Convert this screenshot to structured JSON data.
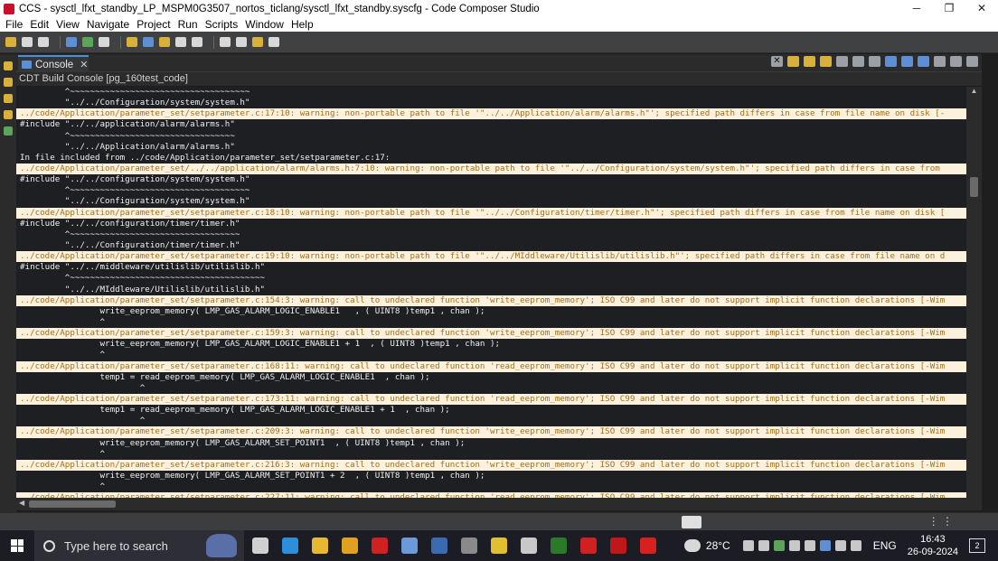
{
  "window": {
    "title": "CCS - sysctl_lfxt_standby_LP_MSPM0G3507_nortos_ticlang/sysctl_lfxt_standby.syscfg - Code Composer Studio",
    "minimize": "─",
    "maximize": "❐",
    "close": "✕"
  },
  "menu": [
    "File",
    "Edit",
    "View",
    "Navigate",
    "Project",
    "Run",
    "Scripts",
    "Window",
    "Help"
  ],
  "console_tab": {
    "label": "Console",
    "close": "✕"
  },
  "console_header": "CDT Build Console [pg_160test_code]",
  "console_lines": [
    {
      "text": "         ^~~~~~~~~~~~~~~~~~~~~~~~~~~~~~~~~~~~~",
      "warn": false
    },
    {
      "text": "         \"../../Configuration/system/system.h\"",
      "warn": false
    },
    {
      "text": "../code/Application/parameter_set/setparameter.c:17:10: warning: non-portable path to file '\"../../Application/alarm/alarms.h\"'; specified path differs in case from file name on disk [-",
      "warn": true
    },
    {
      "text": "#include \"../../application/alarm/alarms.h\"",
      "warn": false
    },
    {
      "text": "         ^~~~~~~~~~~~~~~~~~~~~~~~~~~~~~~~~~",
      "warn": false
    },
    {
      "text": "         \"../../Application/alarm/alarms.h\"",
      "warn": false
    },
    {
      "text": "In file included from ../code/Application/parameter_set/setparameter.c:17:",
      "warn": false
    },
    {
      "text": "../code/Application/parameter_set/../../application/alarm/alarms.h:7:10: warning: non-portable path to file '\"../../Configuration/system/system.h\"'; specified path differs in case from",
      "warn": true
    },
    {
      "text": "#include \"../../configuration/system/system.h\"",
      "warn": false
    },
    {
      "text": "         ^~~~~~~~~~~~~~~~~~~~~~~~~~~~~~~~~~~~~",
      "warn": false
    },
    {
      "text": "         \"../../Configuration/system/system.h\"",
      "warn": false
    },
    {
      "text": "../code/Application/parameter_set/setparameter.c:18:10: warning: non-portable path to file '\"../../Configuration/timer/timer.h\"'; specified path differs in case from file name on disk [",
      "warn": true
    },
    {
      "text": "#include \"../../configuration/timer/timer.h\"",
      "warn": false
    },
    {
      "text": "         ^~~~~~~~~~~~~~~~~~~~~~~~~~~~~~~~~~~",
      "warn": false
    },
    {
      "text": "         \"../../Configuration/timer/timer.h\"",
      "warn": false
    },
    {
      "text": "../code/Application/parameter_set/setparameter.c:19:10: warning: non-portable path to file '\"../../MIddleware/Utilislib/utilislib.h\"'; specified path differs in case from file name on d",
      "warn": true
    },
    {
      "text": "#include \"../../middleware/utilislib/utilislib.h\"",
      "warn": false
    },
    {
      "text": "         ^~~~~~~~~~~~~~~~~~~~~~~~~~~~~~~~~~~~~~~~",
      "warn": false
    },
    {
      "text": "         \"../../MIddleware/Utilislib/utilislib.h\"",
      "warn": false
    },
    {
      "text": "../code/Application/parameter_set/setparameter.c:154:3: warning: call to undeclared function 'write_eeprom_memory'; ISO C99 and later do not support implicit function declarations [-Wim",
      "warn": true
    },
    {
      "text": "                write_eeprom_memory( LMP_GAS_ALARM_LOGIC_ENABLE1   , ( UINT8 )temp1 , chan );",
      "warn": false
    },
    {
      "text": "                ^",
      "warn": false
    },
    {
      "text": "../code/Application/parameter_set/setparameter.c:159:3: warning: call to undeclared function 'write_eeprom_memory'; ISO C99 and later do not support implicit function declarations [-Wim",
      "warn": true
    },
    {
      "text": "                write_eeprom_memory( LMP_GAS_ALARM_LOGIC_ENABLE1 + 1  , ( UINT8 )temp1 , chan );",
      "warn": false
    },
    {
      "text": "                ^",
      "warn": false
    },
    {
      "text": "../code/Application/parameter_set/setparameter.c:168:11: warning: call to undeclared function 'read_eeprom_memory'; ISO C99 and later do not support implicit function declarations [-Wim",
      "warn": true
    },
    {
      "text": "                temp1 = read_eeprom_memory( LMP_GAS_ALARM_LOGIC_ENABLE1  , chan );",
      "warn": false
    },
    {
      "text": "                        ^",
      "warn": false
    },
    {
      "text": "../code/Application/parameter_set/setparameter.c:173:11: warning: call to undeclared function 'read_eeprom_memory'; ISO C99 and later do not support implicit function declarations [-Wim",
      "warn": true
    },
    {
      "text": "                temp1 = read_eeprom_memory( LMP_GAS_ALARM_LOGIC_ENABLE1 + 1  , chan );",
      "warn": false
    },
    {
      "text": "                        ^",
      "warn": false
    },
    {
      "text": "../code/Application/parameter_set/setparameter.c:209:3: warning: call to undeclared function 'write_eeprom_memory'; ISO C99 and later do not support implicit function declarations [-Wim",
      "warn": true
    },
    {
      "text": "                write_eeprom_memory( LMP_GAS_ALARM_SET_POINT1  , ( UINT8 )temp1 , chan );",
      "warn": false
    },
    {
      "text": "                ^",
      "warn": false
    },
    {
      "text": "../code/Application/parameter_set/setparameter.c:216:3: warning: call to undeclared function 'write_eeprom_memory'; ISO C99 and later do not support implicit function declarations [-Wim",
      "warn": true
    },
    {
      "text": "                write_eeprom_memory( LMP_GAS_ALARM_SET_POINT1 + 2  , ( UINT8 )temp1 , chan );",
      "warn": false
    },
    {
      "text": "                ^",
      "warn": false
    },
    {
      "text": "../code/Application/parameter_set/setparameter.c:227:11: warning: call to undeclared function 'read_eeprom_memory'; ISO C99 and later do not support implicit function declarations [-Wim",
      "warn": true
    }
  ],
  "colors": {
    "warning_bg": "#fbf1dd",
    "warning_fg": "#a46f1d",
    "console_bg": "#1e1f22",
    "accent": "#4a8ed8"
  },
  "taskbar": {
    "search_placeholder": "Type here to search",
    "weather": "28°C",
    "language": "ENG",
    "time": "16:43",
    "date": "26-09-2024",
    "notification_count": "2",
    "apps": [
      {
        "name": "task-view-icon",
        "color": "#d0d0d0"
      },
      {
        "name": "edge-icon",
        "color": "#2d8fdc"
      },
      {
        "name": "file-explorer-icon",
        "color": "#e8b830"
      },
      {
        "name": "chrome-icon",
        "color": "#e0a020"
      },
      {
        "name": "app-red-cube-icon",
        "color": "#d02020"
      },
      {
        "name": "app-globe-icon",
        "color": "#6a9ad8"
      },
      {
        "name": "calculator-icon",
        "color": "#3a6ab0"
      },
      {
        "name": "app-gray-icon",
        "color": "#8a8a8a"
      },
      {
        "name": "app-yellow-t-icon",
        "color": "#e0c030"
      },
      {
        "name": "app-tools-icon",
        "color": "#c8c8c8"
      },
      {
        "name": "app-ccs-icon",
        "color": "#2a7a2a"
      },
      {
        "name": "app-red-s-icon",
        "color": "#d02020"
      },
      {
        "name": "app-red-cube2-icon",
        "color": "#c01818"
      },
      {
        "name": "app-flash-icon",
        "color": "#d82020"
      }
    ]
  }
}
